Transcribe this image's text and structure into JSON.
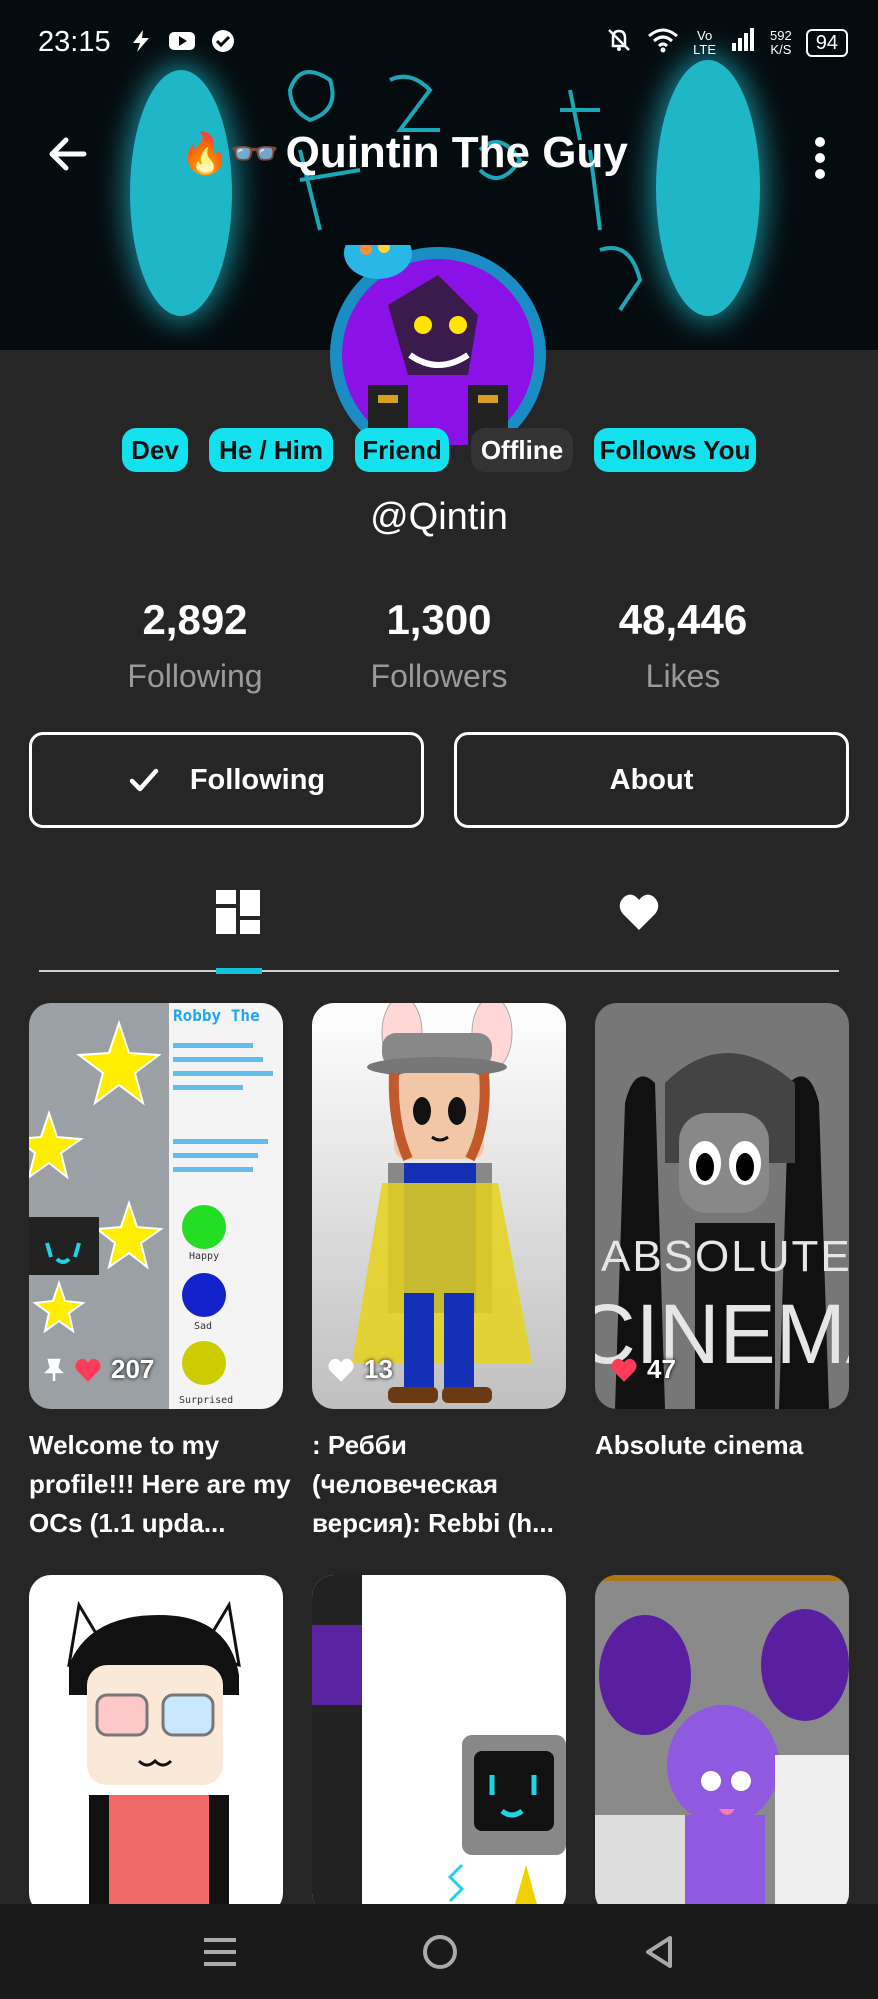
{
  "status_bar": {
    "time": "23:15",
    "lte_top": "Vo",
    "lte_bottom": "LTE",
    "net_speed_value": "592",
    "net_speed_unit": "K/S",
    "battery": "94"
  },
  "header": {
    "title_emoji": "🔥👓",
    "title": "Quintin The Guy"
  },
  "tags": [
    {
      "label": "Dev"
    },
    {
      "label": "He / Him"
    },
    {
      "label": "Friend"
    },
    {
      "label": "Offline"
    },
    {
      "label": "Follows You"
    }
  ],
  "username": "@Qintin",
  "stats": [
    {
      "value": "2,892",
      "label": "Following"
    },
    {
      "value": "1,300",
      "label": "Followers"
    },
    {
      "value": "48,446",
      "label": "Likes"
    }
  ],
  "buttons": {
    "following": "Following",
    "about": "About"
  },
  "posts": [
    {
      "likes": "207",
      "caption": "Welcome to my profile!!! Here are my OCs (1.1 upda...",
      "pinned": true,
      "image_text": "Robby The",
      "image_labels": [
        "Happy",
        "Sad",
        "Surprised"
      ]
    },
    {
      "likes": "13",
      "caption": ": Ребби (человеческая версия): Rebbi (h...",
      "pinned": false
    },
    {
      "likes": "47",
      "caption": "Absolute cinema",
      "pinned": false,
      "image_text_1": "ABSOLUTE",
      "image_text_2": "CINEMA"
    },
    {
      "likes": "",
      "caption": ""
    },
    {
      "likes": "",
      "caption": ""
    },
    {
      "likes": "",
      "caption": ""
    }
  ],
  "colors": {
    "accent": "#13e1ee",
    "background": "#262626",
    "heart": "#ff3b5c"
  }
}
